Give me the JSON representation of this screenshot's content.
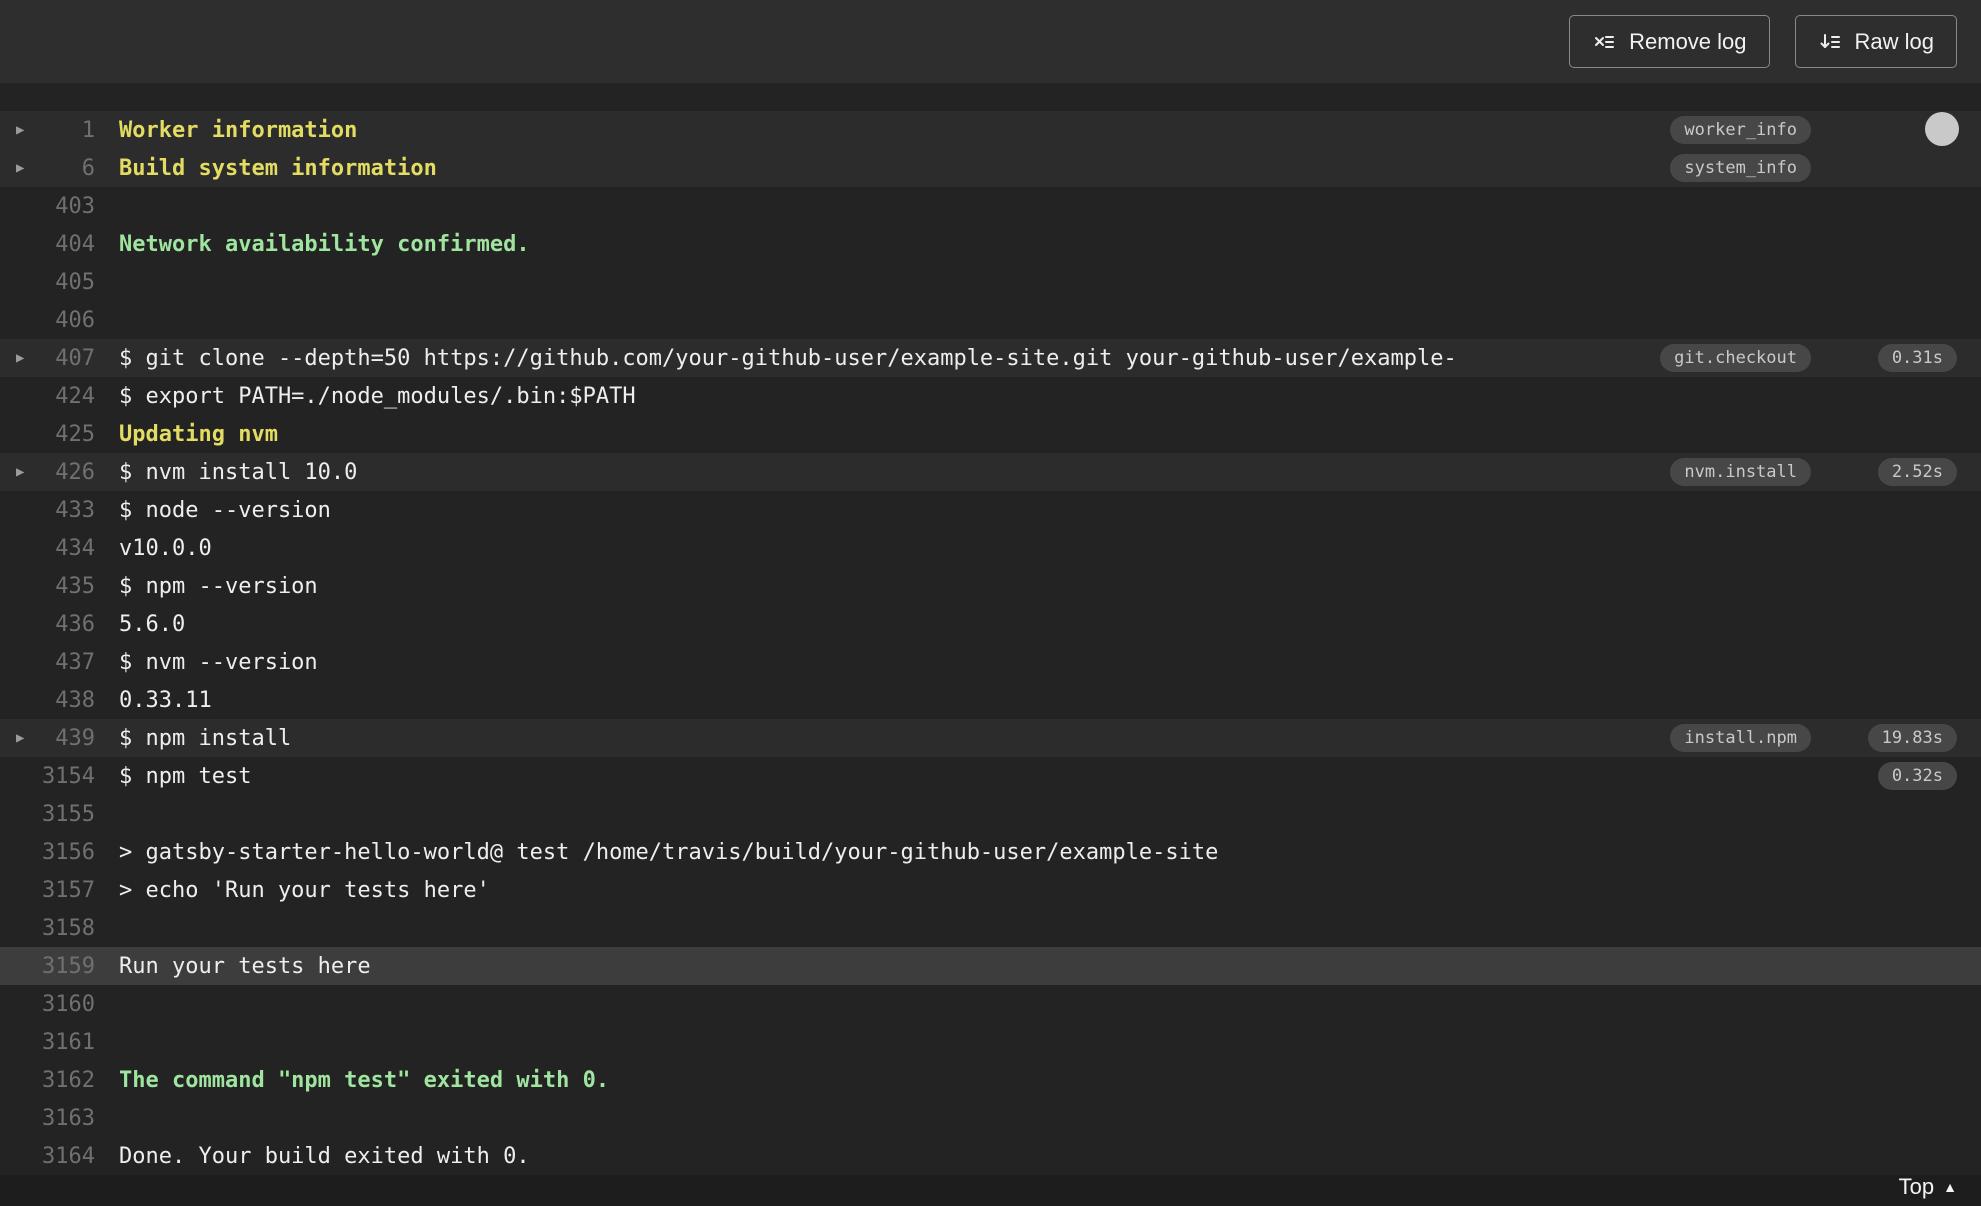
{
  "toolbar": {
    "remove_log": {
      "label": "Remove log"
    },
    "raw_log": {
      "label": "Raw log"
    }
  },
  "log": {
    "lines": [
      {
        "number": "1",
        "text": "Worker information",
        "color": "yellow",
        "bold": true,
        "fold": true,
        "badge": "worker_info",
        "section": true
      },
      {
        "number": "6",
        "text": "Build system information",
        "color": "yellow",
        "bold": true,
        "fold": true,
        "badge": "system_info",
        "section": true
      },
      {
        "number": "403",
        "text": ""
      },
      {
        "number": "404",
        "text": "Network availability confirmed.",
        "color": "green",
        "bold": true
      },
      {
        "number": "405",
        "text": ""
      },
      {
        "number": "406",
        "text": ""
      },
      {
        "number": "407",
        "text": "$ git clone --depth=50 https://github.com/your-github-user/example-site.git your-github-user/example-",
        "fold": true,
        "badge": "git.checkout",
        "time": "0.31s",
        "section": true
      },
      {
        "number": "424",
        "text": "$ export PATH=./node_modules/.bin:$PATH"
      },
      {
        "number": "425",
        "text": "Updating nvm",
        "color": "yellow",
        "bold": true
      },
      {
        "number": "426",
        "text": "$ nvm install 10.0",
        "fold": true,
        "badge": "nvm.install",
        "time": "2.52s",
        "section": true
      },
      {
        "number": "433",
        "text": "$ node --version"
      },
      {
        "number": "434",
        "text": "v10.0.0"
      },
      {
        "number": "435",
        "text": "$ npm --version"
      },
      {
        "number": "436",
        "text": "5.6.0"
      },
      {
        "number": "437",
        "text": "$ nvm --version"
      },
      {
        "number": "438",
        "text": "0.33.11"
      },
      {
        "number": "439",
        "text": "$ npm install",
        "fold": true,
        "badge": "install.npm",
        "time": "19.83s",
        "section": true
      },
      {
        "number": "3154",
        "text": "$ npm test",
        "time": "0.32s"
      },
      {
        "number": "3155",
        "text": ""
      },
      {
        "number": "3156",
        "text": "> gatsby-starter-hello-world@ test /home/travis/build/your-github-user/example-site"
      },
      {
        "number": "3157",
        "text": "> echo 'Run your tests here'"
      },
      {
        "number": "3158",
        "text": ""
      },
      {
        "number": "3159",
        "text": "Run your tests here",
        "highlight": true
      },
      {
        "number": "3160",
        "text": ""
      },
      {
        "number": "3161",
        "text": ""
      },
      {
        "number": "3162",
        "text": "The command \"npm test\" exited with 0.",
        "color": "green",
        "bold": true
      },
      {
        "number": "3163",
        "text": ""
      },
      {
        "number": "3164",
        "text": "Done. Your build exited with 0."
      }
    ]
  },
  "footer": {
    "top_label": "Top"
  },
  "colors": {
    "background": "#232323",
    "topbar": "#2e2e2e",
    "yellow": "#e3dc62",
    "green": "#9fe49f",
    "text": "#eeeeee",
    "line_number": "#707070",
    "badge_bg": "#474747",
    "section_row_bg": "#2c2c2c",
    "highlight_row_bg": "#3d3d3d"
  }
}
